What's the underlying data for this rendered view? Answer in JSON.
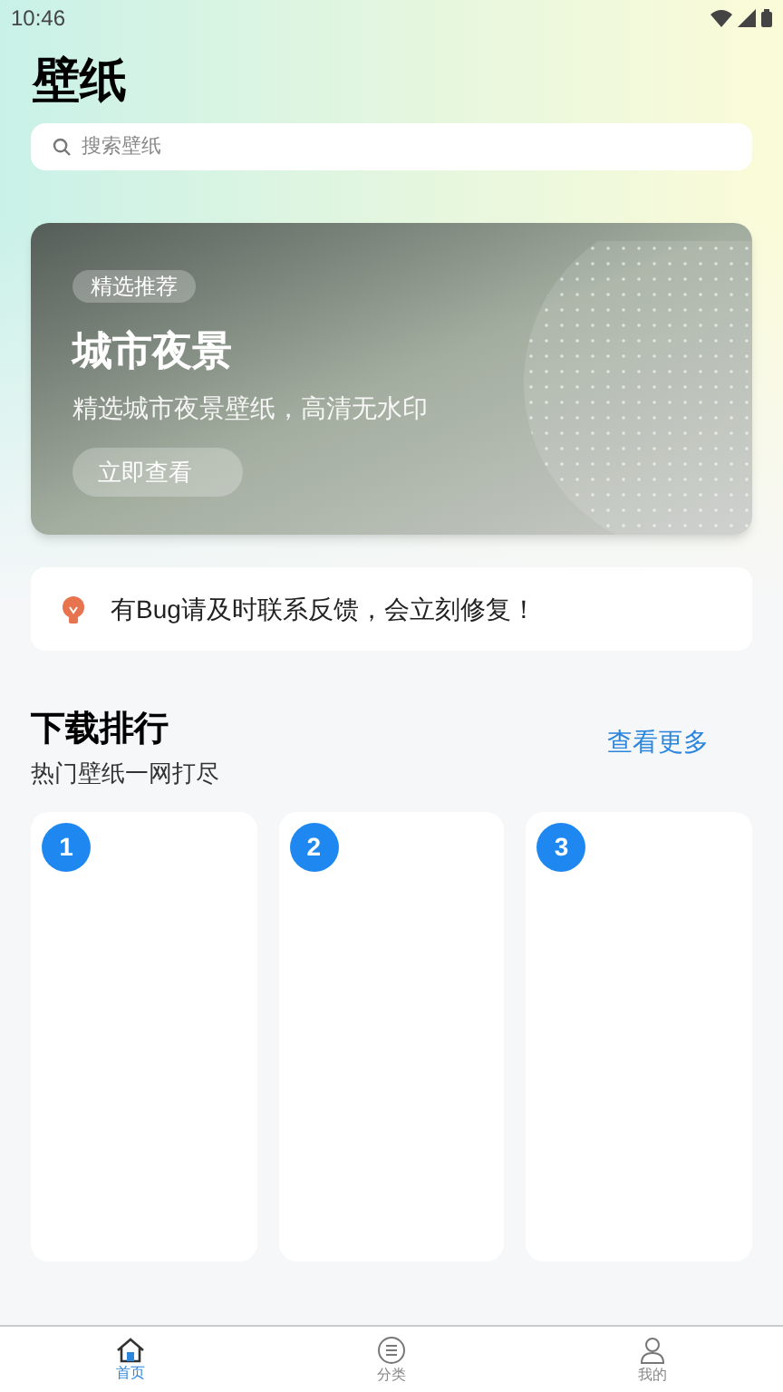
{
  "status_bar": {
    "time": "10:46"
  },
  "header": {
    "title": "壁纸",
    "search": {
      "placeholder": "搜索壁纸"
    }
  },
  "banner": {
    "tag": "精选推荐",
    "title": "城市夜景",
    "subtitle": "精选城市夜景壁纸，高清无水印",
    "button": "立即查看"
  },
  "notice": {
    "text": "有Bug请及时联系反馈，会立刻修复！"
  },
  "ranking": {
    "title": "下载排行",
    "subtitle": "热门壁纸一网打尽",
    "more": "查看更多",
    "items": [
      {
        "rank": "1"
      },
      {
        "rank": "2"
      },
      {
        "rank": "3"
      }
    ]
  },
  "tabs": [
    {
      "label": "首页",
      "kind": "home",
      "selected": true
    },
    {
      "label": "分类",
      "kind": "category",
      "selected": false
    },
    {
      "label": "我的",
      "kind": "profile",
      "selected": false
    }
  ]
}
